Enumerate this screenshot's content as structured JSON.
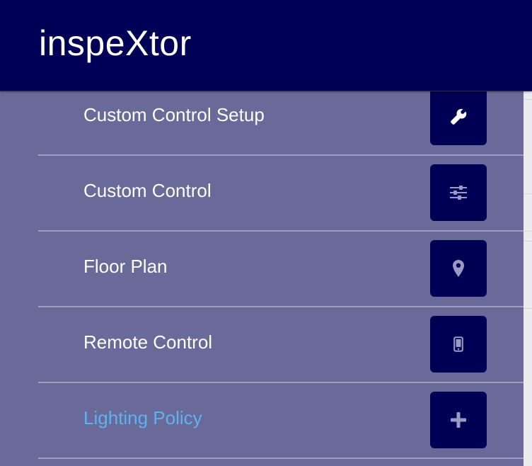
{
  "header": {
    "title": "inspeXtor"
  },
  "menu": {
    "items": [
      {
        "label": "Custom Control Setup",
        "icon": "wrench-icon",
        "active": false
      },
      {
        "label": "Custom Control",
        "icon": "sliders-icon",
        "active": false
      },
      {
        "label": "Floor Plan",
        "icon": "map-pin-icon",
        "active": false
      },
      {
        "label": "Remote Control",
        "icon": "mobile-phone-icon",
        "active": false
      },
      {
        "label": "Lighting Policy",
        "icon": "plus-icon",
        "active": true
      }
    ]
  },
  "colors": {
    "header_bg": "#000057",
    "drawer_bg": "#696a99",
    "icon_button_bg": "#000055",
    "active_label": "#5fb2ee",
    "label": "#ffffff"
  }
}
